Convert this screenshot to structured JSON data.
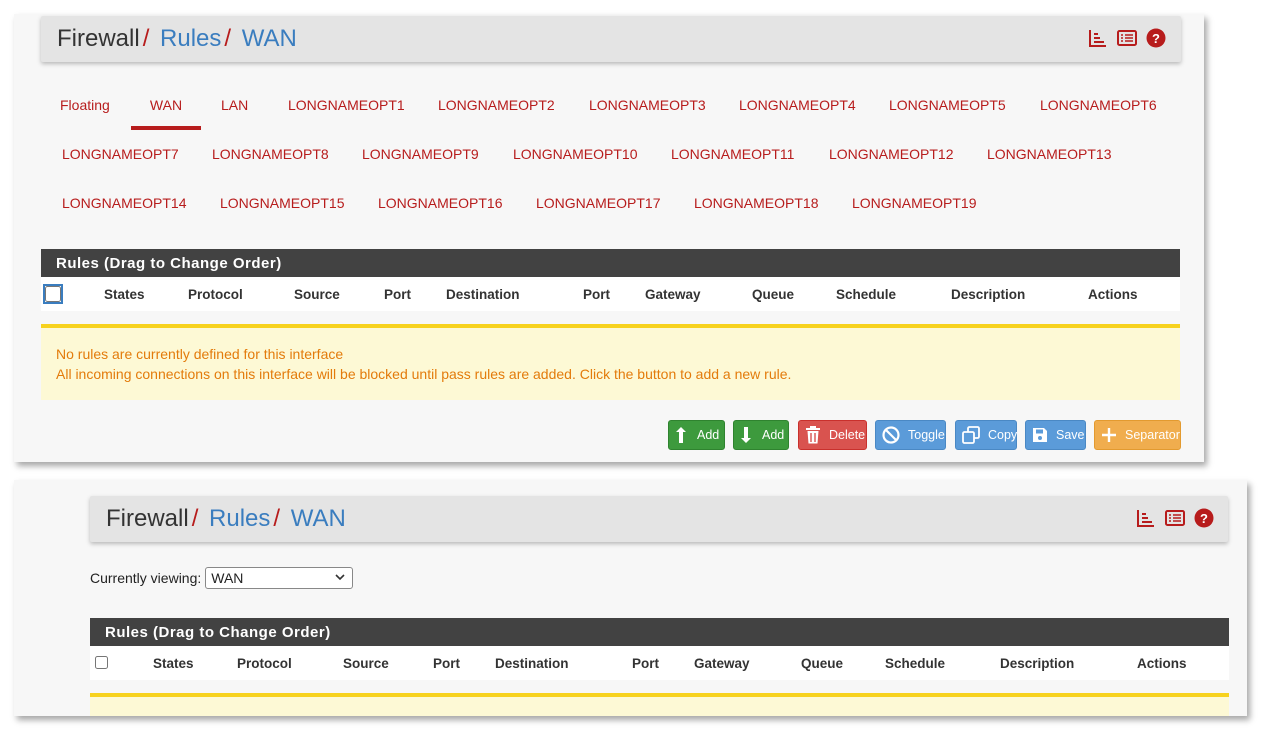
{
  "breadcrumb": {
    "home": "Firewall",
    "sep1": "/",
    "rules": "Rules",
    "sep2": "/",
    "iface": "WAN"
  },
  "header_icons": [
    "bar-chart-icon",
    "list-icon",
    "help-icon"
  ],
  "tabs_row1": [
    "Floating",
    "WAN",
    "LAN",
    "LONGNAMEOPT1",
    "LONGNAMEOPT2",
    "LONGNAMEOPT3",
    "LONGNAMEOPT4",
    "LONGNAMEOPT5",
    "LONGNAMEOPT6"
  ],
  "tabs_row2": [
    "LONGNAMEOPT7",
    "LONGNAMEOPT8",
    "LONGNAMEOPT9",
    "LONGNAMEOPT10",
    "LONGNAMEOPT11",
    "LONGNAMEOPT12",
    "LONGNAMEOPT13"
  ],
  "tabs_row3": [
    "LONGNAMEOPT14",
    "LONGNAMEOPT15",
    "LONGNAMEOPT16",
    "LONGNAMEOPT17",
    "LONGNAMEOPT18",
    "LONGNAMEOPT19"
  ],
  "active_tab": "WAN",
  "panel": {
    "title": "Rules (Drag to Change Order)"
  },
  "columns": [
    "States",
    "Protocol",
    "Source",
    "Port",
    "Destination",
    "Port",
    "Gateway",
    "Queue",
    "Schedule",
    "Description",
    "Actions"
  ],
  "alert": {
    "line1": "No rules are currently defined for this interface",
    "line2": "All incoming connections on this interface will be blocked until pass rules are added. Click the button to add a new rule."
  },
  "buttons": {
    "add_top": "Add",
    "add_bottom": "Add",
    "delete": "Delete",
    "toggle": "Toggle",
    "copy": "Copy",
    "save": "Save",
    "separator": "Separator"
  },
  "viewing": {
    "label": "Currently viewing:",
    "value": "WAN"
  },
  "colors": {
    "brand_red": "#b71c1c",
    "link_blue": "#3a7dbf",
    "panel_dark": "#424242",
    "alert_text": "#e37b0b"
  }
}
